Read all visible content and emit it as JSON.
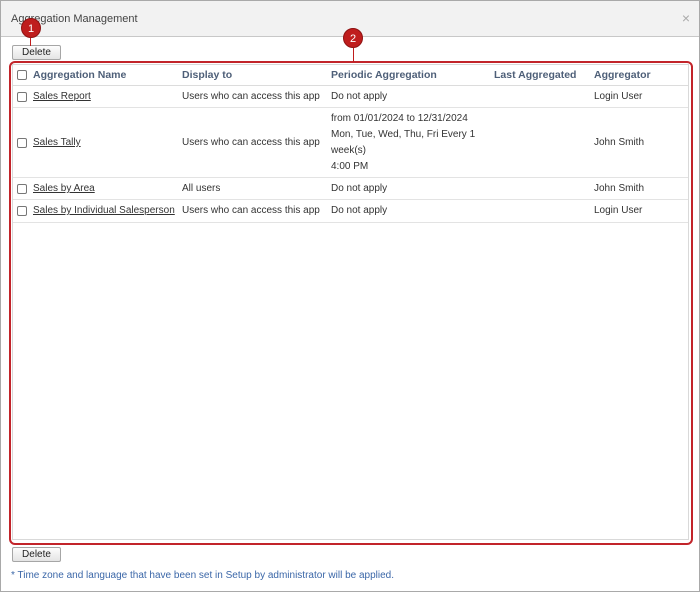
{
  "window": {
    "title": "Aggregation Management",
    "close_glyph": "×"
  },
  "toolbar": {
    "delete_label": "Delete"
  },
  "annotations": {
    "marker_1": "1",
    "marker_2": "2"
  },
  "table": {
    "headers": {
      "name": "Aggregation Name",
      "display": "Display to",
      "periodic": "Periodic Aggregation",
      "last": "Last Aggregated",
      "aggregator": "Aggregator"
    },
    "rows": [
      {
        "name": "Sales Report",
        "display": "Users who can access this app",
        "periodic": [
          "Do not apply"
        ],
        "last": "",
        "aggregator": "Login User"
      },
      {
        "name": "Sales Tally",
        "display": "Users who can access this app",
        "periodic": [
          "from 01/01/2024 to 12/31/2024",
          "Mon, Tue, Wed, Thu, Fri Every 1",
          "week(s)",
          "4:00 PM"
        ],
        "last": "",
        "aggregator": "John Smith"
      },
      {
        "name": "Sales by Area",
        "display": "All users",
        "periodic": [
          "Do not apply"
        ],
        "last": "",
        "aggregator": "John Smith"
      },
      {
        "name": "Sales by Individual Salesperson",
        "display": "Users who can access this app",
        "periodic": [
          "Do not apply"
        ],
        "last": "",
        "aggregator": "Login User"
      }
    ]
  },
  "footer": {
    "delete_label": "Delete",
    "note": "* Time zone and language that have been set in Setup by administrator will be applied."
  },
  "colors": {
    "link": "#1a46c2",
    "header_text": "#4e5f78",
    "annotation": "#bf1d1d"
  }
}
